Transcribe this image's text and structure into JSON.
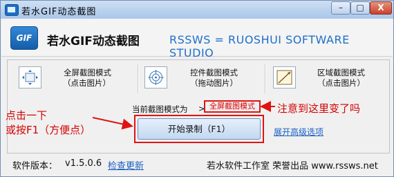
{
  "window": {
    "title": "若水GIF动态截图",
    "buttons": {
      "minimize": "–",
      "maximize": "□",
      "close": "X"
    }
  },
  "header": {
    "logo_text": "GIF",
    "app_name": "若水GIF动态截图",
    "studio": "RSSWS = RUOSHUI SOFTWARE STUDIO"
  },
  "modes": [
    {
      "label": "全屏截图模式",
      "hint": "（点击图片）",
      "icon": "fullscreen-capture-icon"
    },
    {
      "label": "控件截图模式",
      "hint": "（拖动图片）",
      "icon": "crosshair-target-icon"
    },
    {
      "label": "区域截图模式",
      "hint": "（点击图片）",
      "icon": "region-capture-icon"
    }
  ],
  "current": {
    "label": "当前截图模式为",
    "separator": ">",
    "value": "全屏截图模式"
  },
  "start_button": "开始录制（F1）",
  "advanced_link": "展开高级选项",
  "annotations": {
    "top_right": "注意到这里变了吗",
    "left_line1": "点击一下",
    "left_line2": "或按F1（方便点）",
    "color": "#d50000"
  },
  "footer": {
    "version_label": "软件版本：",
    "version": "v1.5.0.6",
    "check_update": "检查更新",
    "studio": "若水软件工作室 荣誉出品 www.rssws.net"
  },
  "colors": {
    "accent": "#1e6fc8",
    "link": "#1a5fc4",
    "highlight": "#e01313"
  }
}
